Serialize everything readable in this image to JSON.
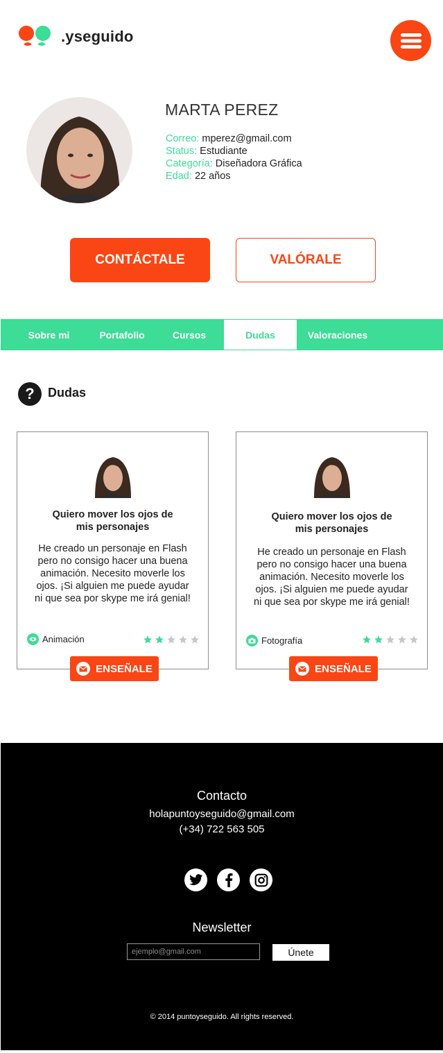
{
  "header": {
    "logo_text": ".yseguido",
    "menu_icon": "hamburger-icon"
  },
  "profile": {
    "name": "MARTA PEREZ",
    "fields": [
      {
        "label": "Correo:",
        "value": "mperez@gmail.com"
      },
      {
        "label": "Status:",
        "value": "Estudiante"
      },
      {
        "label": "Categoría:",
        "value": "Diseñadora Gráfica"
      },
      {
        "label": "Edad:",
        "value": "22 años"
      }
    ],
    "contact_label": "CONTÁCTALE",
    "rate_label": "VALÓRALE"
  },
  "tabs": [
    {
      "label": "Sobre mi"
    },
    {
      "label": "Portafolio"
    },
    {
      "label": "Cursos"
    },
    {
      "label": "Dudas",
      "active": true
    },
    {
      "label": "Valoraciones"
    }
  ],
  "section": {
    "icon": "question-icon",
    "title": "Dudas"
  },
  "cards": [
    {
      "title_line1": "Quiero mover los ojos de",
      "title_line2": "mis personajes",
      "body": [
        "He creado un personaje en Flash",
        "pero no consigo hacer una buena",
        "animación. Necesito moverle los",
        "ojos. ¡Si alguien me puede ayudar",
        "ni que sea por skype me irá genial!"
      ],
      "category": "Animación",
      "category_icon": "eye-icon",
      "rating": 2,
      "max_rating": 5,
      "button_label": "ENSEÑALE"
    },
    {
      "title_line1": "Quiero mover los ojos de",
      "title_line2": "mis personajes",
      "body": [
        "He creado un personaje en Flash",
        "pero no consigo hacer una buena",
        "animación. Necesito moverle los",
        "ojos. ¡Si alguien me puede ayudar",
        "ni que sea por skype me irá genial!"
      ],
      "category": "Fotografía",
      "category_icon": "camera-icon",
      "rating": 2,
      "max_rating": 5,
      "button_label": "ENSEÑALE"
    }
  ],
  "footer": {
    "contact_title": "Contacto",
    "email": "holapuntoyseguido@gmail.com",
    "phone": "(+34) 722 563 505",
    "social": [
      "twitter-icon",
      "facebook-icon",
      "instagram-icon"
    ],
    "newsletter_title": "Newsletter",
    "newsletter_placeholder": "ejemplo@gmail.com",
    "newsletter_button": "Únete",
    "copyright": "© 2014 puntoyseguido. All rights reserved."
  },
  "colors": {
    "accent": "#fa4614",
    "green": "#3ddc97",
    "footer_bg": "#000000"
  }
}
